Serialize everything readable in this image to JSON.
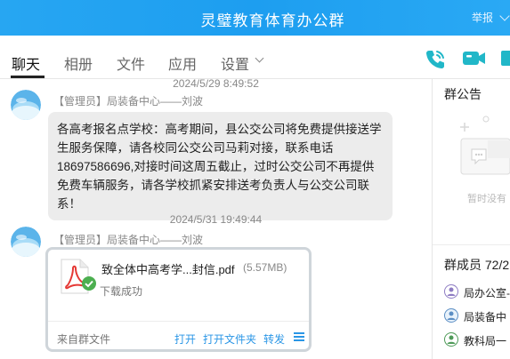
{
  "window": {
    "title": "灵璧教育体育办公群",
    "report_label": "举报"
  },
  "tabs": [
    {
      "label": "聊天",
      "active": true
    },
    {
      "label": "相册",
      "active": false
    },
    {
      "label": "文件",
      "active": false
    },
    {
      "label": "应用",
      "active": false
    },
    {
      "label": "设置",
      "active": false
    }
  ],
  "toolbar": {
    "icons": [
      "phone-call-icon",
      "video-call-icon",
      "screen-share-icon"
    ],
    "accent_color": "#21b7c8"
  },
  "messages": [
    {
      "timestamp": "2024/5/29 8:49:52",
      "sender": "【管理员】局装备中心——刘波",
      "text": "各高考报名点学校：高考期间，县公交公司将免费提供接送学生服务保障，请各校同公交公司马莉对接，联系电话18697586696,对接时间这周五截止，过时公交公司不再提供免费车辆服务，请各学校抓紧安排送考负责人与公交公司联系！"
    },
    {
      "timestamp": "2024/5/31 19:49:44",
      "sender": "【管理员】局装备中心——刘波",
      "file": {
        "name": "致全体中高考学...封信.pdf",
        "size": "(5.57MB)",
        "status": "下载成功",
        "source": "来自群文件",
        "actions": [
          "打开",
          "打开文件夹",
          "转发"
        ]
      }
    }
  ],
  "sidebar": {
    "announcement_title": "群公告",
    "announcement_empty": "暂时没有",
    "members_title": "群成员 72/2",
    "members": [
      {
        "name": "局办公室-"
      },
      {
        "name": "局装备中"
      },
      {
        "name": "教科局一"
      }
    ]
  },
  "colors": {
    "titlebar": "#1d9ef0",
    "link": "#2a96e6",
    "bubble": "#ececec"
  }
}
